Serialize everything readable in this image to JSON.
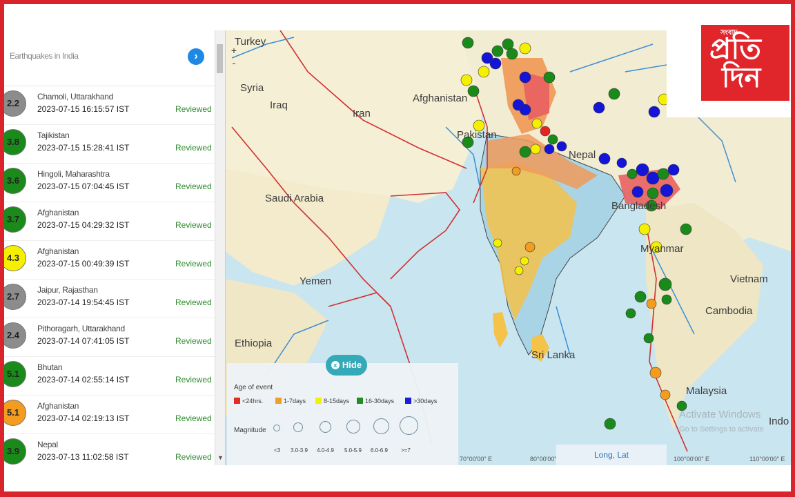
{
  "panel": {
    "title": "Earthquakes in India",
    "go_icon": "chevron-right-icon",
    "events": [
      {
        "magnitude": "2.2",
        "place": "Chamoli, Uttarakhand",
        "time": "2023-07-15 16:15:57 IST",
        "status": "Reviewed",
        "color": "#8c8c8c"
      },
      {
        "magnitude": "3.8",
        "place": "Tajikistan",
        "time": "2023-07-15 15:28:41 IST",
        "status": "Reviewed",
        "color": "#1a8a1a"
      },
      {
        "magnitude": "3.6",
        "place": "Hingoli, Maharashtra",
        "time": "2023-07-15 07:04:45 IST",
        "status": "Reviewed",
        "color": "#1a8a1a"
      },
      {
        "magnitude": "3.7",
        "place": "Afghanistan",
        "time": "2023-07-15 04:29:32 IST",
        "status": "Reviewed",
        "color": "#1a8a1a"
      },
      {
        "magnitude": "4.3",
        "place": "Afghanistan",
        "time": "2023-07-15 00:49:39 IST",
        "status": "Reviewed",
        "color": "#f5f000"
      },
      {
        "magnitude": "2.7",
        "place": "Jaipur, Rajasthan",
        "time": "2023-07-14 19:54:45 IST",
        "status": "Reviewed",
        "color": "#8c8c8c"
      },
      {
        "magnitude": "2.4",
        "place": "Pithoragarh, Uttarakhand",
        "time": "2023-07-14 07:41:05 IST",
        "status": "Reviewed",
        "color": "#8c8c8c"
      },
      {
        "magnitude": "5.1",
        "place": "Bhutan",
        "time": "2023-07-14 02:55:14 IST",
        "status": "Reviewed",
        "color": "#1a8a1a"
      },
      {
        "magnitude": "5.1",
        "place": "Afghanistan",
        "time": "2023-07-14 02:19:13 IST",
        "status": "Reviewed",
        "color": "#f39c1f"
      },
      {
        "magnitude": "3.9",
        "place": "Nepal",
        "time": "2023-07-13 11:02:58 IST",
        "status": "Reviewed",
        "color": "#1a8a1a"
      }
    ]
  },
  "map": {
    "countries": [
      "Turkey",
      "Syria",
      "Iraq",
      "Iran",
      "Afghanistan",
      "Pakistan",
      "Nepal",
      "Saudi Arabia",
      "Yemen",
      "Ethiopia",
      "Bangladesh",
      "Myanmar",
      "Vietnam",
      "Cambodia",
      "Sri Lanka",
      "Malaysia",
      "Indo"
    ],
    "zoom_in": "+",
    "zoom_out": "-",
    "coord_label": "Long, Lat",
    "ticks": [
      "70°00'00\" E",
      "80°00'00\" E",
      "100°00'00\" E",
      "110°00'00\" E"
    ]
  },
  "legend": {
    "hide_label": "Hide",
    "age_title": "Age of event",
    "age_items": [
      {
        "label": "<24hrs.",
        "color": "#e52420"
      },
      {
        "label": "1-7days",
        "color": "#f39c1f"
      },
      {
        "label": "8-15days",
        "color": "#f5f000"
      },
      {
        "label": "16-30days",
        "color": "#1a8a1a"
      },
      {
        "label": ">30days",
        "color": "#1515d8"
      }
    ],
    "magnitude_title": "Magnitude",
    "magnitude_items": [
      "<3",
      "3.0-3.9",
      "4.0-4.9",
      "5.0-5.9",
      "6.0-6.9",
      ">=7"
    ]
  },
  "watermark": {
    "line1": "Activate Windows",
    "line2": "Go to Settings to activate"
  },
  "logo": {
    "small": "সংবাদ",
    "line1": "প্রতি",
    "line2": "দিন"
  }
}
